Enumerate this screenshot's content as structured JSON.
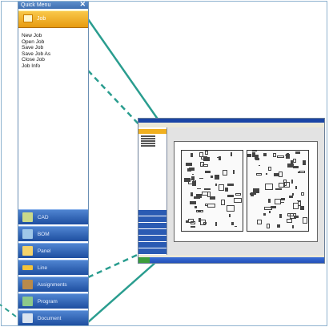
{
  "quick_menu": {
    "title": "Quick Menu",
    "close_glyph": "✕",
    "job": {
      "label": "Job",
      "icon": "folder-icon"
    },
    "job_items": [
      "New Job",
      "Open Job",
      "Save Job",
      "Save Job As",
      "Close Job",
      "Job Info"
    ],
    "nav": [
      {
        "label": "CAD",
        "icon": "cad-icon",
        "color": "#c9d98a"
      },
      {
        "label": "BOM",
        "icon": "bom-icon",
        "color": "#9fc7e8"
      },
      {
        "label": "Panel",
        "icon": "panel-icon",
        "color": "#f5d36a"
      },
      {
        "label": "Line",
        "icon": "line-icon",
        "color": "#f3c33b"
      },
      {
        "label": "Assignments",
        "icon": "assignments-icon",
        "color": "#b98a4a"
      },
      {
        "label": "Program",
        "icon": "program-icon",
        "color": "#8dc98a"
      },
      {
        "label": "Document",
        "icon": "document-icon",
        "color": "#d9e3f0"
      }
    ]
  },
  "colors": {
    "accent_line": "#2a9d8f",
    "job_orange": "#f0a824",
    "nav_blue": "#2f63b8"
  }
}
